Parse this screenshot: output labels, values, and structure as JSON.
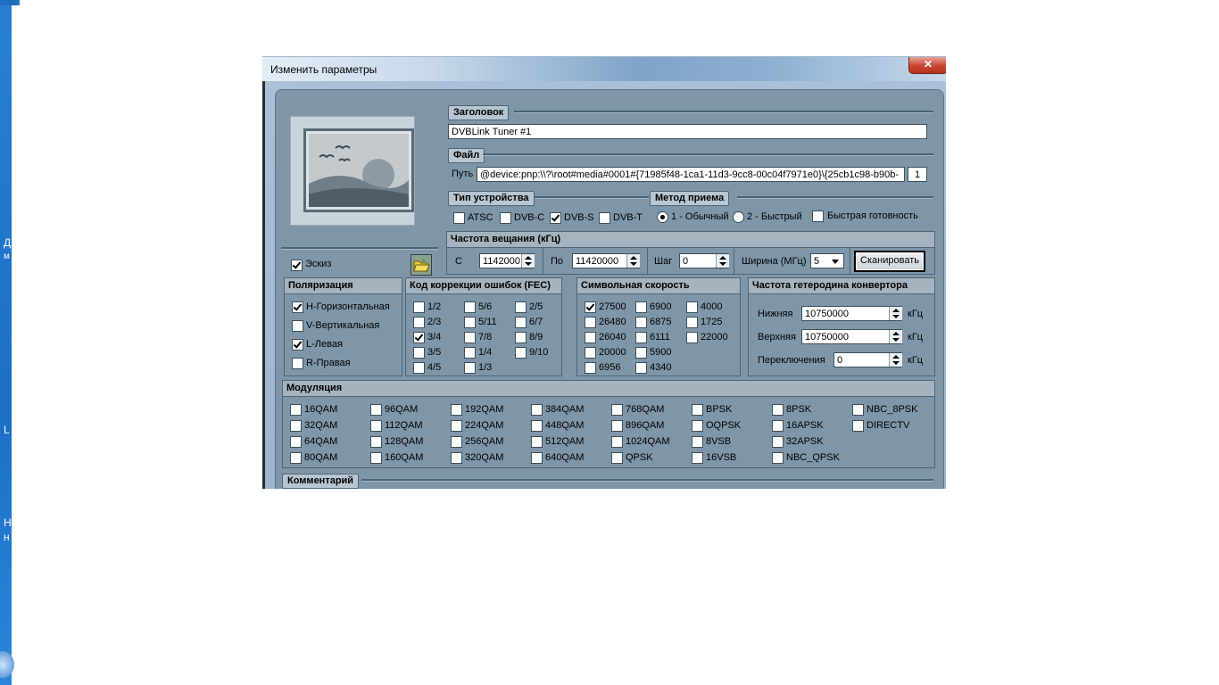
{
  "desktop": {
    "edge_chars": [
      "Д",
      "м",
      "L",
      "Н",
      "н"
    ]
  },
  "window": {
    "title": "Изменить параметры",
    "close": "✕"
  },
  "header_section": {
    "label": "Заголовок",
    "value": "DVBLink Tuner #1"
  },
  "file_section": {
    "label": "Файл",
    "path_label": "Путь",
    "path_value": "@device:pnp:\\\\?\\root#media#0001#{71985f48-1ca1-11d3-9cc8-00c04f7971e0}\\{25cb1c98-b90b-",
    "index_value": "1"
  },
  "device_type": {
    "label": "Тип устройства",
    "options": [
      {
        "label": "ATSC",
        "checked": false
      },
      {
        "label": "DVB-C",
        "checked": false
      },
      {
        "label": "DVB-S",
        "checked": true
      },
      {
        "label": "DVB-T",
        "checked": false
      }
    ]
  },
  "reception": {
    "label": "Метод приема",
    "radio1": "1 - Обычный",
    "radio2": "2 - Быстрый",
    "fast_ready": "Быстрая готовность"
  },
  "thumbnail": {
    "label": "Эскиз",
    "checked": true
  },
  "frequency": {
    "label": "Частота вещания (кГц)",
    "from_label": "С",
    "from_value": "1142000",
    "to_label": "По",
    "to_value": "11420000",
    "step_label": "Шаг",
    "step_value": "0",
    "width_label": "Ширина (МГц)",
    "width_value": "5",
    "scan_button": "Сканировать"
  },
  "polarization": {
    "label": "Поляризация",
    "items": [
      {
        "label": "H-Горизонтальная",
        "checked": true
      },
      {
        "label": "V-Вертикальная",
        "checked": false
      },
      {
        "label": "L-Левая",
        "checked": true
      },
      {
        "label": "R-Правая",
        "checked": false
      }
    ]
  },
  "fec": {
    "label": "Код коррекции ошибок (FEC)",
    "items": [
      {
        "label": "1/2",
        "checked": false
      },
      {
        "label": "5/6",
        "checked": false
      },
      {
        "label": "2/5",
        "checked": false
      },
      {
        "label": "2/3",
        "checked": false
      },
      {
        "label": "5/11",
        "checked": false
      },
      {
        "label": "6/7",
        "checked": false
      },
      {
        "label": "3/4",
        "checked": true
      },
      {
        "label": "7/8",
        "checked": false
      },
      {
        "label": "8/9",
        "checked": false
      },
      {
        "label": "3/5",
        "checked": false
      },
      {
        "label": "1/4",
        "checked": false
      },
      {
        "label": "9/10",
        "checked": false
      },
      {
        "label": "4/5",
        "checked": false
      },
      {
        "label": "1/3",
        "checked": false
      }
    ]
  },
  "symbol_rate": {
    "label": "Символьная скорость",
    "items": [
      {
        "label": "27500",
        "checked": true
      },
      {
        "label": "6900",
        "checked": false
      },
      {
        "label": "4000",
        "checked": false
      },
      {
        "label": "26480",
        "checked": false
      },
      {
        "label": "6875",
        "checked": false
      },
      {
        "label": "1725",
        "checked": false
      },
      {
        "label": "26040",
        "checked": false
      },
      {
        "label": "6111",
        "checked": false
      },
      {
        "label": "22000",
        "checked": false
      },
      {
        "label": "20000",
        "checked": false
      },
      {
        "label": "5900",
        "checked": false
      },
      {
        "label": "6956",
        "checked": false
      },
      {
        "label": "4340",
        "checked": false
      }
    ]
  },
  "lnb": {
    "label": "Частота гетеродина конвертора",
    "low_label": "Нижняя",
    "low_value": "10750000",
    "high_label": "Верхняя",
    "high_value": "10750000",
    "switch_label": "Переключения",
    "switch_value": "0",
    "unit": "кГц"
  },
  "modulation": {
    "label": "Модуляция",
    "items": [
      {
        "label": "16QAM",
        "checked": false
      },
      {
        "label": "96QAM",
        "checked": false
      },
      {
        "label": "192QAM",
        "checked": false
      },
      {
        "label": "384QAM",
        "checked": false
      },
      {
        "label": "768QAM",
        "checked": false
      },
      {
        "label": "BPSK",
        "checked": false
      },
      {
        "label": "8PSK",
        "checked": false
      },
      {
        "label": "NBC_8PSK",
        "checked": false
      },
      {
        "label": "32QAM",
        "checked": false
      },
      {
        "label": "112QAM",
        "checked": false
      },
      {
        "label": "224QAM",
        "checked": false
      },
      {
        "label": "448QAM",
        "checked": false
      },
      {
        "label": "896QAM",
        "checked": false
      },
      {
        "label": "OQPSK",
        "checked": false
      },
      {
        "label": "16APSK",
        "checked": false
      },
      {
        "label": "DIRECTV",
        "checked": false
      },
      {
        "label": "64QAM",
        "checked": false
      },
      {
        "label": "128QAM",
        "checked": false
      },
      {
        "label": "256QAM",
        "checked": false
      },
      {
        "label": "512QAM",
        "checked": false
      },
      {
        "label": "1024QAM",
        "checked": false
      },
      {
        "label": "8VSB",
        "checked": false
      },
      {
        "label": "32APSK",
        "checked": false
      },
      {
        "label": "80QAM",
        "checked": false
      },
      {
        "label": "160QAM",
        "checked": false
      },
      {
        "label": "320QAM",
        "checked": false
      },
      {
        "label": "640QAM",
        "checked": false
      },
      {
        "label": "QPSK",
        "checked": false
      },
      {
        "label": "16VSB",
        "checked": false
      },
      {
        "label": "NBC_QPSK",
        "checked": false
      }
    ]
  },
  "comment": {
    "label": "Комментарий"
  },
  "icons": {
    "preview": "landscape-image-icon",
    "browse": "folder-open-icon"
  },
  "colors": {
    "client_bg": "#7e96a8",
    "header_bg": "#b7c6d1",
    "close_red": "#c7452f"
  }
}
